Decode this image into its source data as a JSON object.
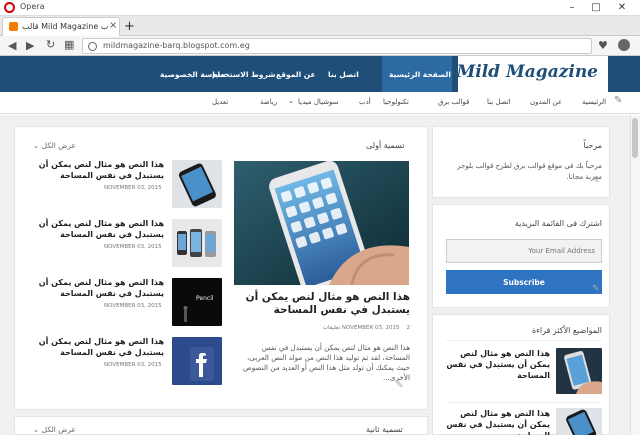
{
  "browser": {
    "app_name": "Opera",
    "tab_title": "قالب Mild Magazine معرب",
    "url": "mildmagazine-barq.blogspot.com.eg"
  },
  "site": {
    "logo": "Mild Magazine",
    "main_nav": [
      "الصفحة الرئيسية",
      "اتصل بنا",
      "عن الموقع",
      "شروط الاستخدام",
      "سياسة الخصوصية"
    ],
    "sub_nav": [
      "الرئيسية",
      "عن المدون",
      "اتصل بنا",
      "قوالب برق",
      "تكنولوجيا",
      "أدب",
      "سوشيال ميديا",
      "رياضة",
      "تعديل"
    ]
  },
  "main": {
    "section1_title": "تسمية أولى",
    "view_all": "عرض الكل",
    "featured": {
      "title": "هذا النص هو مثال لنص يمكن أن يستبدل في نفس المساحة",
      "date": "NOVEMBER 03, 2015",
      "comments": "2 تعليقات",
      "excerpt": "هذا النص هو مثال لنص يمكن أن يستبدل في نفس المساحة، لقد تم توليد هذا النص من مولد النص العربى، حيث يمكنك أن تولد مثل هذا النص أو العديد من النصوص الأخرى..."
    },
    "posts": [
      {
        "title": "هذا النص هو مثال لنص يمكن أن يستبدل في نفس المساحة",
        "date": "NOVEMBER 03, 2015"
      },
      {
        "title": "هذا النص هو مثال لنص يمكن أن يستبدل في نفس المساحة",
        "date": "NOVEMBER 03, 2015"
      },
      {
        "title": "هذا النص هو مثال لنص يمكن أن يستبدل في نفس المساحة",
        "date": "NOVEMBER 03, 2015"
      },
      {
        "title": "هذا النص هو مثال لنص يمكن أن يستبدل في نفس المساحة",
        "date": "NOVEMBER 03, 2015"
      }
    ],
    "section2_title": "تسمية ثانية",
    "view_all_2": "عرض الكل"
  },
  "sidebar": {
    "welcome_title": "مرحباً",
    "welcome_text": "مرحباً بك فى موقع قوالب برق لطرح قوالب بلوجر معربة مجانا.",
    "subscribe_title": "اشترك فى القائمة البريدية",
    "email_placeholder": "Your Email Address",
    "subscribe_button": "Subscribe",
    "popular_title": "المواضيع الأكثر قراءة",
    "popular": [
      {
        "title": "هذا النص هو مثال لنص يمكن أن يستبدل في نفس المساحة"
      },
      {
        "title": "هذا النص هو مثال لنص يمكن أن يستبدل في نفس المساحة"
      }
    ]
  }
}
